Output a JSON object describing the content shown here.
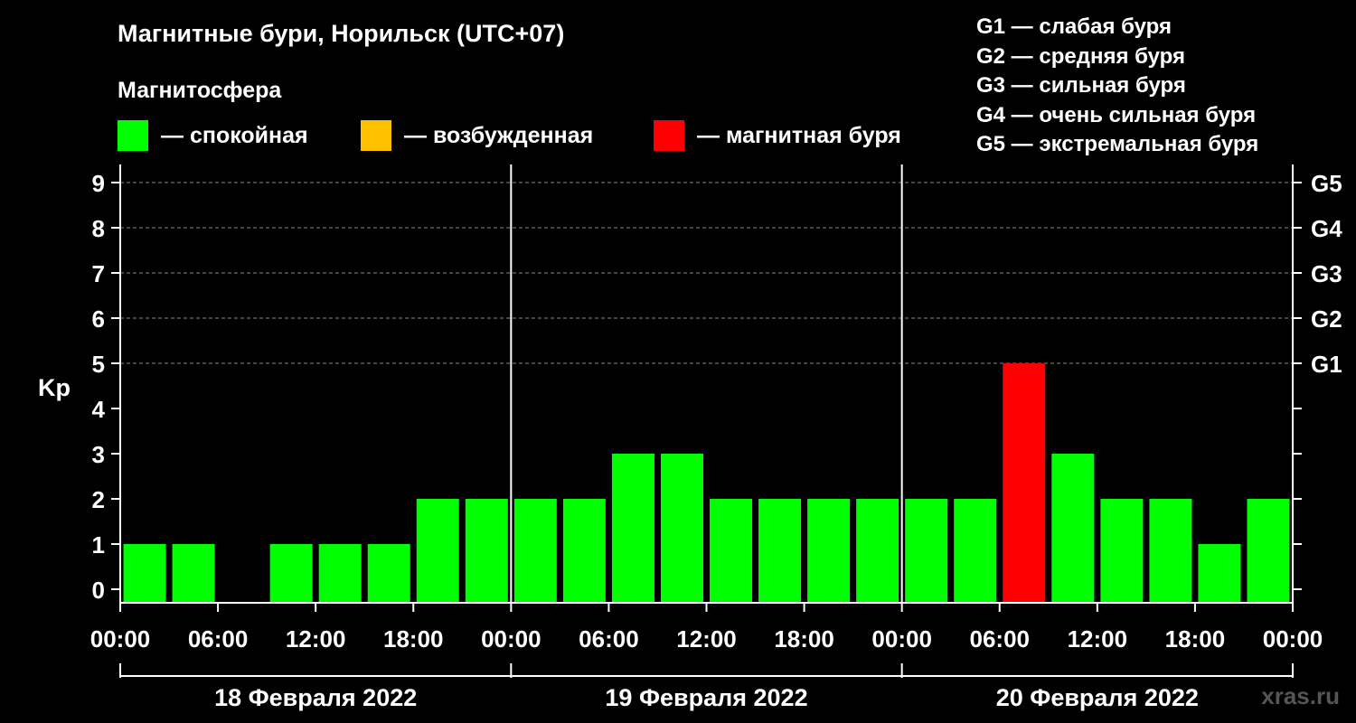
{
  "chart_data": {
    "type": "bar",
    "title": "Магнитные бури, Норильск (UTC+07)",
    "subtitle": "Магнитосфера",
    "ylabel": "Kp",
    "ylim": [
      0,
      9
    ],
    "y_ticks": [
      "0",
      "1",
      "2",
      "3",
      "4",
      "5",
      "6",
      "7",
      "8",
      "9"
    ],
    "g_ticks": [
      {
        "level": 5,
        "label": "G1"
      },
      {
        "level": 6,
        "label": "G2"
      },
      {
        "level": 7,
        "label": "G3"
      },
      {
        "level": 8,
        "label": "G4"
      },
      {
        "level": 9,
        "label": "G5"
      }
    ],
    "x_ticks": [
      "00:00",
      "06:00",
      "12:00",
      "18:00",
      "00:00",
      "06:00",
      "12:00",
      "18:00",
      "00:00",
      "06:00",
      "12:00",
      "18:00",
      "00:00"
    ],
    "days": [
      "18 Февраля 2022",
      "19 Февраля 2022",
      "20 Февраля 2022"
    ],
    "intervals": [
      "00:00–03:00",
      "03:00–06:00",
      "06:00–09:00",
      "09:00–12:00",
      "12:00–15:00",
      "15:00–18:00",
      "18:00–21:00",
      "21:00–00:00"
    ],
    "values": [
      1,
      1,
      0,
      1,
      1,
      1,
      2,
      2,
      2,
      2,
      3,
      3,
      2,
      2,
      2,
      2,
      2,
      2,
      5,
      3,
      2,
      2,
      1,
      2
    ],
    "colors": {
      "quiet": "#00ff00",
      "disturbed": "#ffc000",
      "storm": "#ff0000",
      "grid": "#888888",
      "background": "#000000"
    },
    "legend": [
      {
        "key": "quiet",
        "label": "— спокойная"
      },
      {
        "key": "disturbed",
        "label": "— возбужденная"
      },
      {
        "key": "storm",
        "label": "— магнитная буря"
      }
    ],
    "storm_scale": [
      "G1 — слабая буря",
      "G2 — средняя буря",
      "G3 — сильная буря",
      "G4 — очень сильная буря",
      "G5 — экстремальная буря"
    ],
    "grid": true
  },
  "watermark": "xras.ru"
}
